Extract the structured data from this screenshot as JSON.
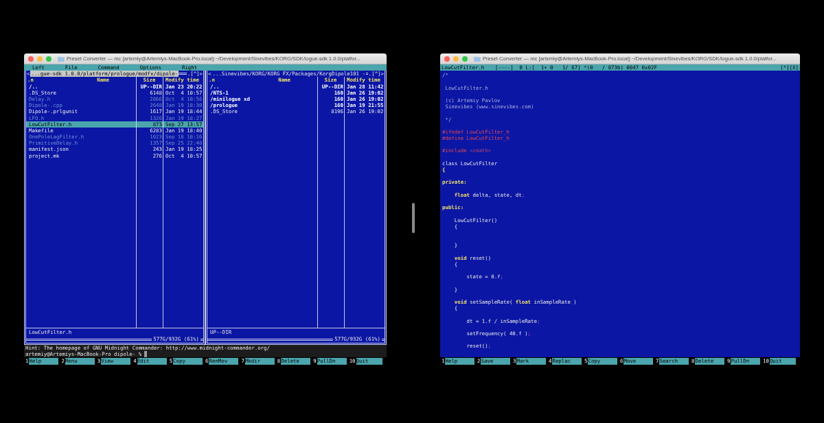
{
  "windows": [
    {
      "kind": "file_manager",
      "title": "Preset Converter — mc [artemiy@Artemiys-MacBook-Pro.local]:~/Development/Sinevibes/KORG/SDK/logue-sdk 1.0.0/platfor...",
      "menu": [
        "Left",
        "File",
        "Command",
        "Options",
        "Right"
      ],
      "panels": [
        {
          "active": true,
          "nav_left": "<",
          "path": "...gue-sdk 1.0.0/platform/prologue/modfx/dipole-",
          "nav_right": ".[^]>",
          "columns": [
            ".n",
            "Name",
            "Size",
            "Modify time"
          ],
          "rows": [
            {
              "name": "/..",
              "size": "UP--DIR",
              "time": "Jan 23 20:22",
              "kind": "dir",
              "selected": false
            },
            {
              "name": ".DS_Store",
              "size": "6148",
              "time": "Oct  4 10:57",
              "kind": "file",
              "selected": false
            },
            {
              "name": "Delay.h",
              "size": "2866",
              "time": "Oct  4 10:56",
              "kind": "source",
              "selected": false
            },
            {
              "name": "Dipole-.cpp",
              "size": "2648",
              "time": "Jan 19 18:30",
              "kind": "source",
              "selected": false
            },
            {
              "name": "Dipole-.prlgunit",
              "size": "1617",
              "time": "Jan 19 18:44",
              "kind": "file",
              "selected": false
            },
            {
              "name": "LFO.h",
              "size": "1326",
              "time": "Jan 19 18:27",
              "kind": "source",
              "selected": false
            },
            {
              "name": "LowCutFilter.h",
              "size": "873",
              "time": "Sep 27 13:57",
              "kind": "source",
              "selected": true
            },
            {
              "name": "Makefile",
              "size": "6283",
              "time": "Jan 19 18:40",
              "kind": "file",
              "selected": false
            },
            {
              "name": "OnePoleLagFilter.h",
              "size": "1023",
              "time": "Sep 18 10:16",
              "kind": "source",
              "selected": false
            },
            {
              "name": "PrimitiveDelay.h",
              "size": "1357",
              "time": "Sep 25 22:40",
              "kind": "source",
              "selected": false
            },
            {
              "name": "manifest.json",
              "size": "243",
              "time": "Jan 19 18:25",
              "kind": "file",
              "selected": false
            },
            {
              "name": "project.mk",
              "size": "276",
              "time": "Oct  4 10:57",
              "kind": "file",
              "selected": false
            }
          ],
          "status": "LowCutFilter.h",
          "disk": "577G/932G (61%)"
        },
        {
          "active": false,
          "nav_left": "<",
          "path": "...Sinevibes/KORG/KORG FX/Packages/KorgDipole101 -",
          "nav_right": ".[^]>",
          "columns": [
            ".n",
            "Name",
            "Size",
            "Modify time"
          ],
          "rows": [
            {
              "name": "/..",
              "size": "UP--DIR",
              "time": "Jan 28 11:42",
              "kind": "dir",
              "selected": false
            },
            {
              "name": "/NTS-1",
              "size": "160",
              "time": "Jan 26 19:02",
              "kind": "dir",
              "selected": false
            },
            {
              "name": "/minilogue xd",
              "size": "160",
              "time": "Jan 26 19:02",
              "kind": "dir",
              "selected": false
            },
            {
              "name": "/prologue",
              "size": "160",
              "time": "Jan 19 21:55",
              "kind": "dir",
              "selected": false
            },
            {
              "name": ".DS_Store",
              "size": "8196",
              "time": "Jan 26 19:02",
              "kind": "file",
              "selected": false
            }
          ],
          "status": "UP--DIR",
          "disk": "577G/932G (61%)"
        }
      ],
      "hint": "Hint: The homepage of GNU Midnight Commander: http://www.midnight-commander.org/",
      "prompt": "artemiy@Artemiys-MacBook-Pro dipole- %",
      "fkeys": [
        {
          "num": "1",
          "label": "Help"
        },
        {
          "num": "2",
          "label": "Menu"
        },
        {
          "num": "3",
          "label": "View"
        },
        {
          "num": "4",
          "label": "Edit"
        },
        {
          "num": "5",
          "label": "Copy"
        },
        {
          "num": "6",
          "label": "RenMov"
        },
        {
          "num": "7",
          "label": "Mkdir"
        },
        {
          "num": "8",
          "label": "Delete"
        },
        {
          "num": "9",
          "label": "PullDn"
        },
        {
          "num": "10",
          "label": "Quit"
        }
      ]
    },
    {
      "kind": "editor",
      "title": "Preset Converter — mc [artemiy@Artemiys-MacBook-Pro.local]:~/Development/Sinevibes/KORG/SDK/logue-sdk 1.0.0/platfor...",
      "status": {
        "file": "LowCutFilter.h",
        "info": "[----]  0 L:[  1+ 0   1/ 67] *(0   / 873b) 0047 0x02F",
        "buttons": "[*][X]"
      },
      "lines": [
        {
          "kind": "code",
          "tokens": [
            {
              "text": "/*",
              "kind": "comment"
            }
          ]
        },
        {
          "kind": "blank"
        },
        {
          "kind": "code",
          "tokens": [
            {
              "text": " LowCutFilter.h",
              "kind": "comment"
            }
          ]
        },
        {
          "kind": "blank"
        },
        {
          "kind": "code",
          "tokens": [
            {
              "text": " (c) Artemiy Pavlov",
              "kind": "comment"
            }
          ]
        },
        {
          "kind": "code",
          "tokens": [
            {
              "text": " Sinevibes (www.sinevibes.com)",
              "kind": "comment"
            }
          ]
        },
        {
          "kind": "blank"
        },
        {
          "kind": "code",
          "tokens": [
            {
              "text": " */",
              "kind": "comment"
            }
          ]
        },
        {
          "kind": "blank"
        },
        {
          "kind": "code",
          "tokens": [
            {
              "text": "#ifndef LowCutFilter_h",
              "kind": "preproc"
            }
          ]
        },
        {
          "kind": "code",
          "tokens": [
            {
              "text": "#define LowCutFilter_h",
              "kind": "preproc"
            }
          ]
        },
        {
          "kind": "blank"
        },
        {
          "kind": "code",
          "tokens": [
            {
              "text": "#include ",
              "kind": "preproc"
            },
            {
              "text": "<cmath>",
              "kind": "include"
            }
          ]
        },
        {
          "kind": "blank"
        },
        {
          "kind": "code",
          "tokens": [
            {
              "text": "class LowCutFilter",
              "kind": "plain"
            }
          ]
        },
        {
          "kind": "code",
          "tokens": [
            {
              "text": "{",
              "kind": "keyword"
            }
          ]
        },
        {
          "kind": "blank"
        },
        {
          "kind": "code",
          "tokens": [
            {
              "text": "private:",
              "kind": "keyword"
            }
          ]
        },
        {
          "kind": "blank"
        },
        {
          "kind": "code",
          "tokens": [
            {
              "text": "    float",
              "kind": "keyword"
            },
            {
              "text": " delta, state, dt",
              "kind": "plain"
            },
            {
              "text": ";",
              "kind": "punct"
            }
          ]
        },
        {
          "kind": "blank"
        },
        {
          "kind": "code",
          "tokens": [
            {
              "text": "public:",
              "kind": "keyword"
            }
          ]
        },
        {
          "kind": "blank"
        },
        {
          "kind": "code",
          "tokens": [
            {
              "text": "    LowCutFilter()",
              "kind": "plain"
            }
          ]
        },
        {
          "kind": "code",
          "tokens": [
            {
              "text": "    {",
              "kind": "plain"
            }
          ]
        },
        {
          "kind": "blank"
        },
        {
          "kind": "blank"
        },
        {
          "kind": "code",
          "tokens": [
            {
              "text": "    }",
              "kind": "plain"
            }
          ]
        },
        {
          "kind": "blank"
        },
        {
          "kind": "code",
          "tokens": [
            {
              "text": "    void",
              "kind": "keyword"
            },
            {
              "text": " reset()",
              "kind": "plain"
            }
          ]
        },
        {
          "kind": "code",
          "tokens": [
            {
              "text": "    {",
              "kind": "plain"
            }
          ]
        },
        {
          "kind": "blank"
        },
        {
          "kind": "code",
          "tokens": [
            {
              "text": "        state = 0.f",
              "kind": "plain"
            },
            {
              "text": ";",
              "kind": "punct"
            }
          ]
        },
        {
          "kind": "blank"
        },
        {
          "kind": "code",
          "tokens": [
            {
              "text": "    }",
              "kind": "plain"
            }
          ]
        },
        {
          "kind": "blank"
        },
        {
          "kind": "code",
          "tokens": [
            {
              "text": "    void",
              "kind": "keyword"
            },
            {
              "text": " setSampleRate( ",
              "kind": "plain"
            },
            {
              "text": "float",
              "kind": "keyword"
            },
            {
              "text": " inSampleRate )",
              "kind": "plain"
            }
          ]
        },
        {
          "kind": "code",
          "tokens": [
            {
              "text": "    {",
              "kind": "plain"
            }
          ]
        },
        {
          "kind": "blank"
        },
        {
          "kind": "code",
          "tokens": [
            {
              "text": "        dt = 1.f / inSampleRate",
              "kind": "plain"
            },
            {
              "text": ";",
              "kind": "punct"
            }
          ]
        },
        {
          "kind": "blank"
        },
        {
          "kind": "code",
          "tokens": [
            {
              "text": "        setFrequency( 40.f )",
              "kind": "plain"
            },
            {
              "text": ";",
              "kind": "punct"
            }
          ]
        },
        {
          "kind": "blank"
        },
        {
          "kind": "code",
          "tokens": [
            {
              "text": "        reset()",
              "kind": "plain"
            },
            {
              "text": ";",
              "kind": "punct"
            }
          ]
        }
      ],
      "fkeys": [
        {
          "num": "1",
          "label": "Help"
        },
        {
          "num": "2",
          "label": "Save"
        },
        {
          "num": "3",
          "label": "Mark"
        },
        {
          "num": "4",
          "label": "Replac"
        },
        {
          "num": "5",
          "label": "Copy"
        },
        {
          "num": "6",
          "label": "Move"
        },
        {
          "num": "7",
          "label": "Search"
        },
        {
          "num": "8",
          "label": "Delete"
        },
        {
          "num": "9",
          "label": "PullDn"
        },
        {
          "num": "10",
          "label": "Quit"
        }
      ]
    }
  ]
}
